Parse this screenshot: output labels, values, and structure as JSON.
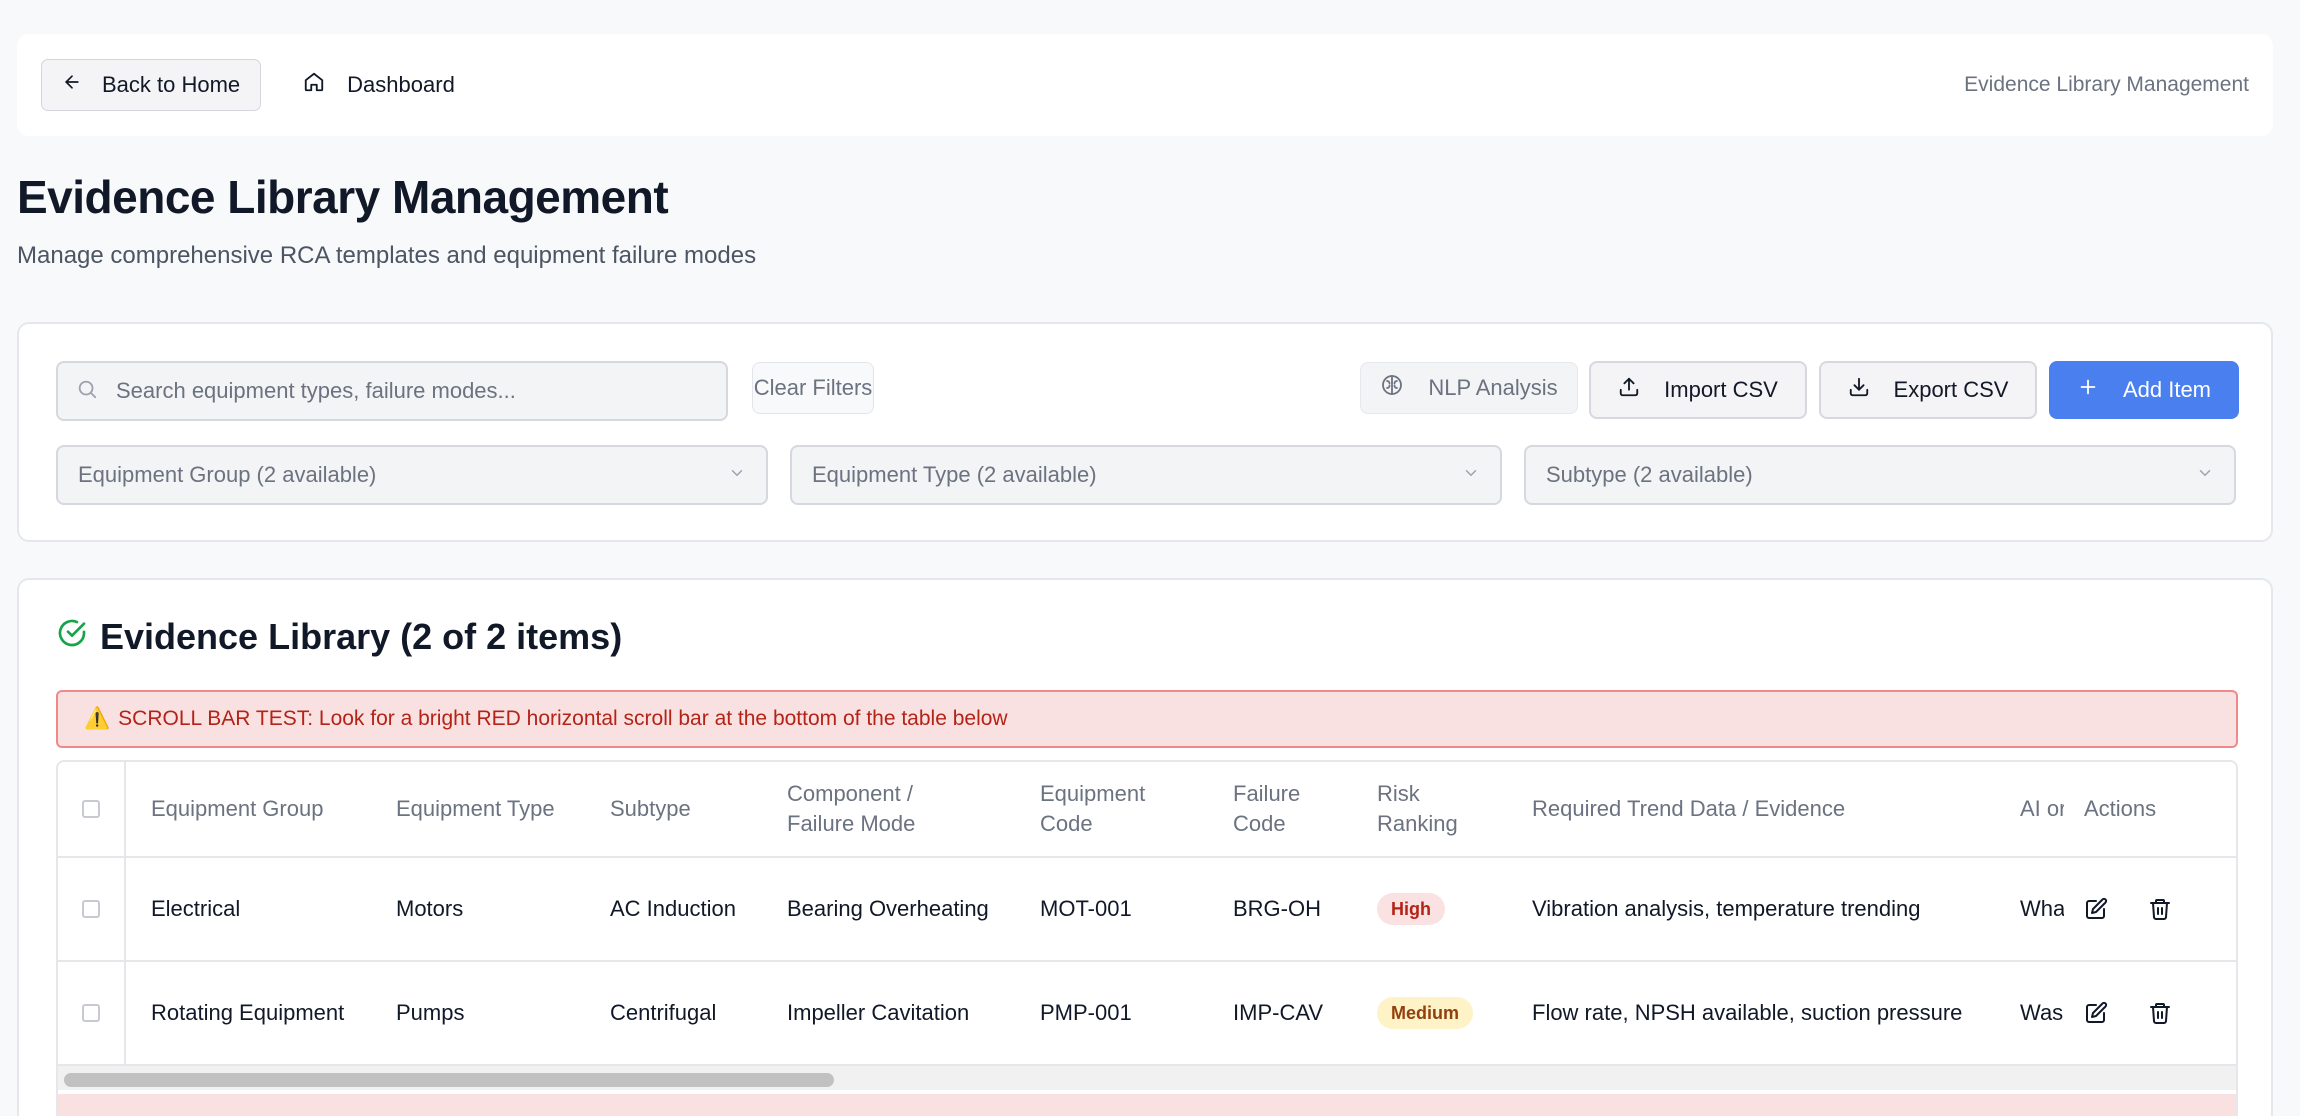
{
  "topbar": {
    "back_label": "Back to Home",
    "dashboard_label": "Dashboard",
    "section_label": "Evidence Library Management"
  },
  "page": {
    "title": "Evidence Library Management",
    "subtitle": "Manage comprehensive RCA templates and equipment failure modes"
  },
  "filters": {
    "search_placeholder": "Search equipment types, failure modes...",
    "clear_label": "Clear Filters",
    "nlp_label": "NLP Analysis",
    "import_label": "Import CSV",
    "export_label": "Export CSV",
    "add_label": "Add Item",
    "equipment_group": "Equipment Group (2 available)",
    "equipment_type": "Equipment Type (2 available)",
    "subtype": "Subtype (2 available)"
  },
  "library": {
    "title": "Evidence Library (2 of 2 items)",
    "alert_icon": "⚠️",
    "alert_text": "SCROLL BAR TEST: Look for a bright RED horizontal scroll bar at the bottom of the table below",
    "columns": {
      "group": "Equipment Group",
      "type": "Equipment Type",
      "subtype": "Subtype",
      "component_line1": "Component /",
      "component_line2": "Failure Mode",
      "code_line1": "Equipment",
      "code_line2": "Code",
      "failure_line1": "Failure",
      "failure_line2": "Code",
      "risk_line1": "Risk",
      "risk_line2": "Ranking",
      "evidence": "Required Trend Data / Evidence",
      "ai": "AI or",
      "actions": "Actions"
    },
    "rows": [
      {
        "group": "Electrical",
        "type": "Motors",
        "subtype": "AC Induction",
        "failure_mode": "Bearing Overheating",
        "equipment_code": "MOT-001",
        "failure_code": "BRG-OH",
        "risk": "High",
        "evidence": "Vibration analysis, temperature trending",
        "ai": "What"
      },
      {
        "group": "Rotating Equipment",
        "type": "Pumps",
        "subtype": "Centrifugal",
        "failure_mode": "Impeller Cavitation",
        "equipment_code": "PMP-001",
        "failure_code": "IMP-CAV",
        "risk": "Medium",
        "evidence": "Flow rate, NPSH available, suction pressure",
        "ai": "Was"
      }
    ]
  },
  "colors": {
    "primary": "#4a7ff0",
    "success": "#16a34a",
    "danger": "#b42318",
    "alert_bg": "#fae1e1"
  }
}
